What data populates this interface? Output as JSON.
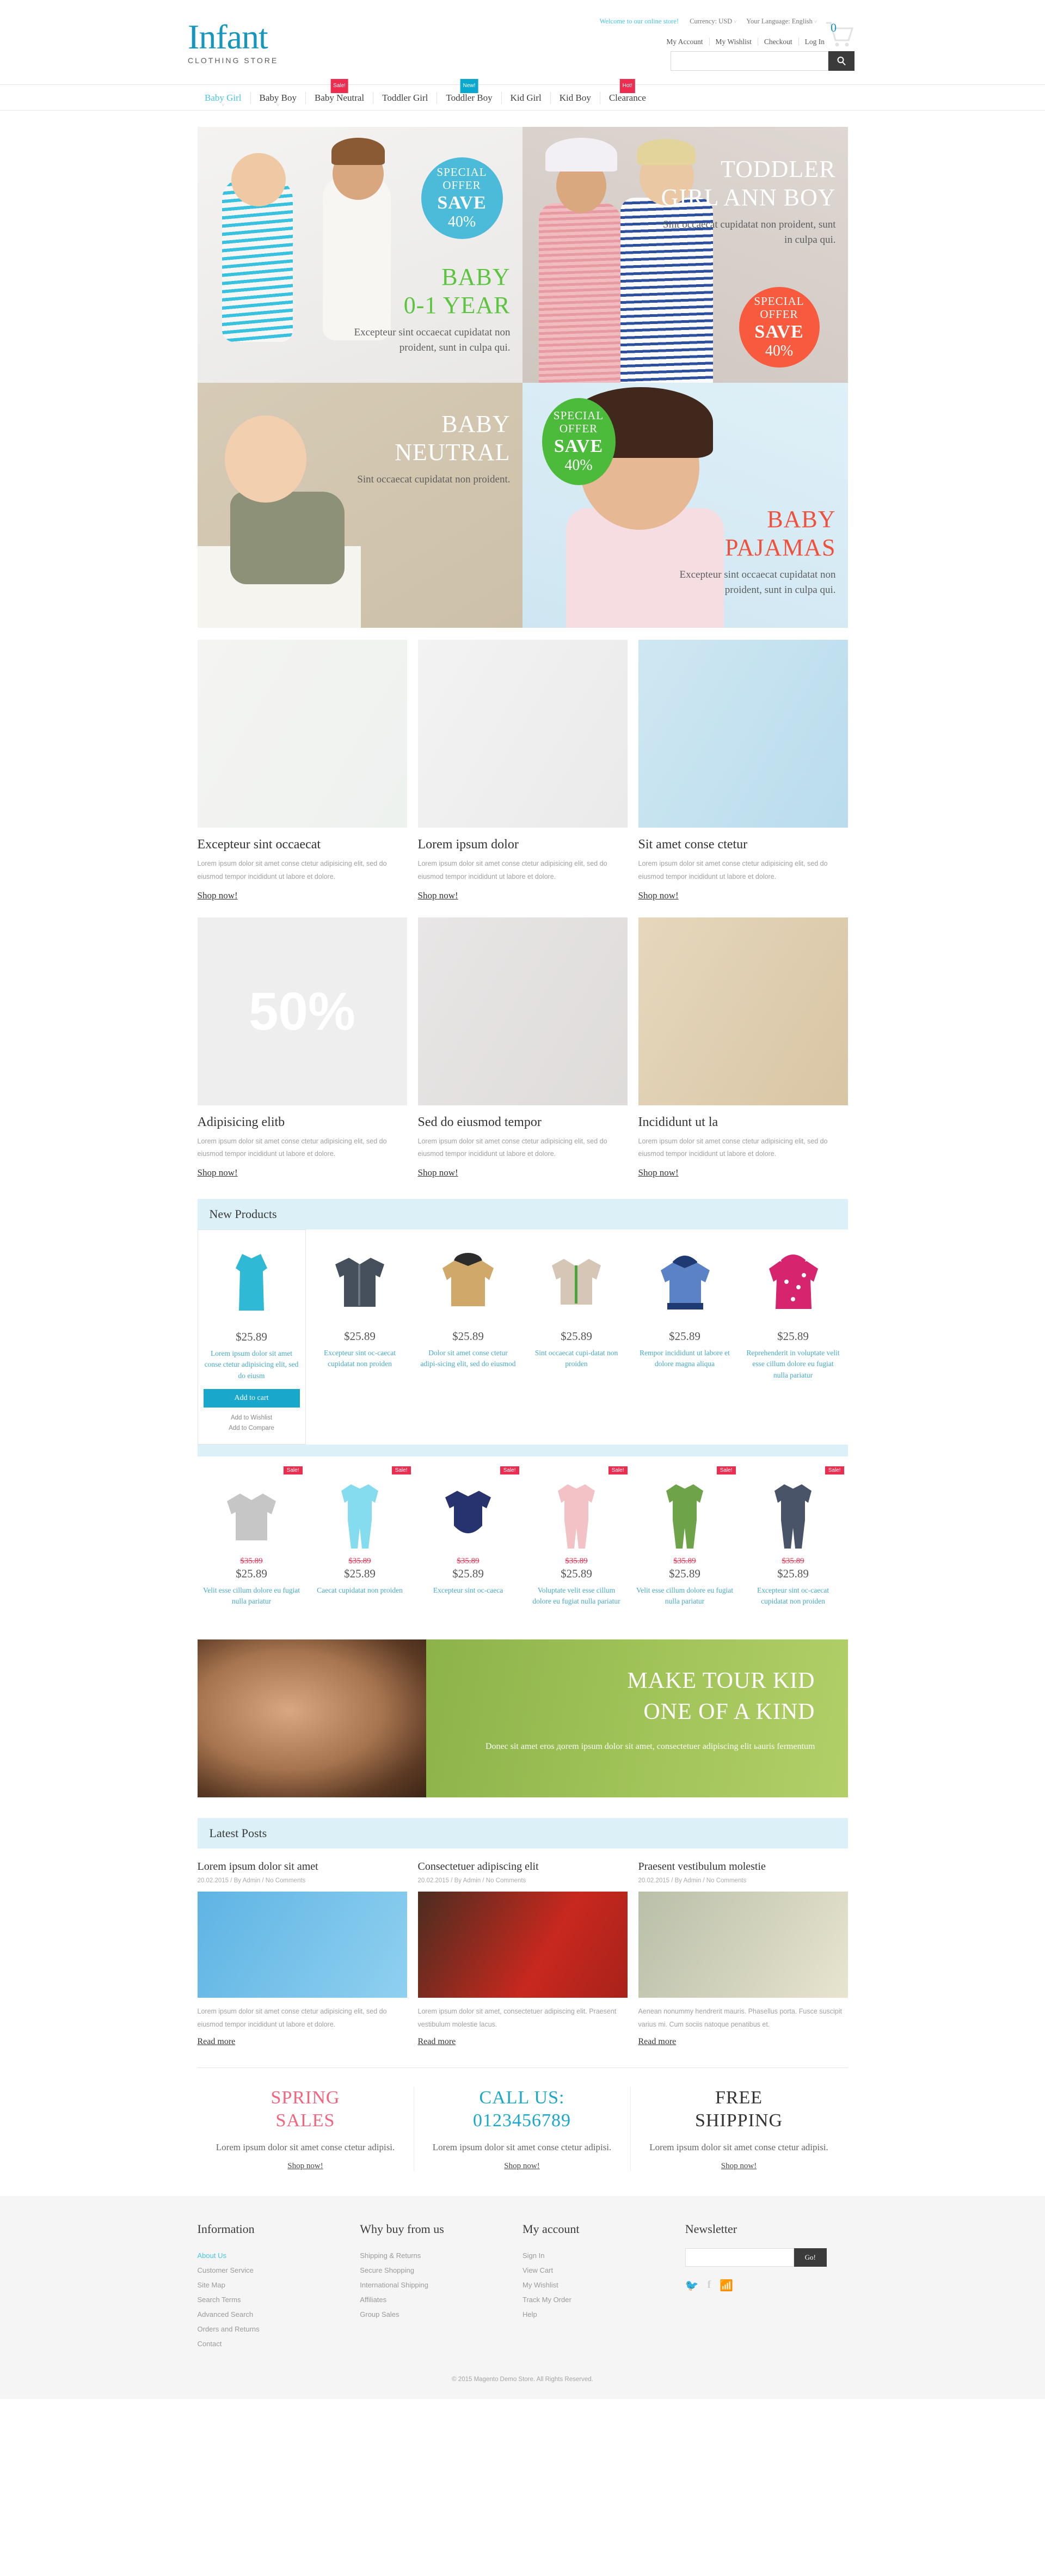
{
  "header": {
    "logo_name": "Infant",
    "logo_sub": "CLOTHING STORE",
    "welcome": "Welcome to our online store!",
    "currency": "Currency: USD",
    "language": "Your Language: English",
    "caret": "˅",
    "cart_count": "0",
    "links": [
      "My Account",
      "My Wishlist",
      "Checkout",
      "Log In"
    ],
    "search_placeholder": "",
    "search_value": "",
    "search_icon": "⚲"
  },
  "nav": {
    "items": [
      {
        "label": "Baby Girl",
        "badge": "",
        "badge_type": "",
        "active": true,
        "dropdown": true
      },
      {
        "label": "Baby Boy",
        "badge": "",
        "badge_type": "",
        "active": false,
        "dropdown": true
      },
      {
        "label": "Baby Neutral",
        "badge": "Sale!",
        "badge_type": "sale",
        "active": false,
        "dropdown": false
      },
      {
        "label": "Toddler Girl",
        "badge": "",
        "badge_type": "",
        "active": false,
        "dropdown": false
      },
      {
        "label": "Toddler Boy",
        "badge": "New!",
        "badge_type": "new",
        "active": false,
        "dropdown": false
      },
      {
        "label": "Kid Girl",
        "badge": "",
        "badge_type": "",
        "active": false,
        "dropdown": false
      },
      {
        "label": "Kid Boy",
        "badge": "",
        "badge_type": "",
        "active": false,
        "dropdown": false
      },
      {
        "label": "Clearance",
        "badge": "Hot!",
        "badge_type": "hot",
        "active": false,
        "dropdown": false
      }
    ]
  },
  "hero": {
    "tl": {
      "circle": {
        "line1": "SPECIAL",
        "line2": "OFFER",
        "line3": "SAVE",
        "line4": "40%",
        "color": "#4bbbd9"
      },
      "title1": "BABY",
      "title2": "0-1 YEAR",
      "text": "Excepteur sint occaecat cupidatat non proident, sunt in culpa qui."
    },
    "tr": {
      "circle": {
        "line1": "SPECIAL",
        "line2": "OFFER",
        "line3": "SAVE",
        "line4": "40%",
        "color": "#f85a3e"
      },
      "title1": "TODDLER",
      "title2": "GIRL ANN BOY",
      "text": "Sint occaecat cupidatat non proident, sunt in culpa qui."
    },
    "bl": {
      "title1": "BABY",
      "title2": "NEUTRAL",
      "text": "Sint occaecat cupidatat non proident."
    },
    "br": {
      "circle": {
        "line1": "SPECIAL",
        "line2": "OFFER",
        "line3": "SAVE",
        "line4": "40%",
        "color": "#4cbb3c"
      },
      "title1": "BABY",
      "title2": "PAJAMAS",
      "text": "Excepteur sint occaecat cupidatat non proident, sunt in culpa qui."
    }
  },
  "categories_row1": [
    {
      "title": "Excepteur sint occaecat",
      "text": "Lorem ipsum dolor sit amet conse ctetur adipisicing elit, sed do eiusmod tempor incididunt ut labore et dolore.",
      "link": "Shop now!"
    },
    {
      "title": "Lorem ipsum dolor",
      "text": "Lorem ipsum dolor sit amet conse ctetur adipisicing elit, sed do eiusmod tempor incididunt ut labore et dolore.",
      "link": "Shop now!"
    },
    {
      "title": "Sit amet conse ctetur",
      "text": "Lorem ipsum dolor sit amet conse ctetur adipisicing elit, sed do eiusmod tempor incididunt ut labore et dolore.",
      "link": "Shop now!"
    }
  ],
  "categories_row2": [
    {
      "title": "Adipisicing elitb",
      "text": "Lorem ipsum dolor sit amet conse ctetur adipisicing elit, sed do eiusmod tempor incididunt ut labore et dolore.",
      "link": "Shop now!",
      "discount": "50%"
    },
    {
      "title": "Sed do eiusmod tempor",
      "text": "Lorem ipsum dolor sit amet conse ctetur adipisicing elit, sed do eiusmod tempor incididunt ut labore et dolore.",
      "link": "Shop now!"
    },
    {
      "title": "Incididunt ut la",
      "text": "Lorem ipsum dolor sit amet conse ctetur adipisicing elit, sed do eiusmod tempor incididunt ut labore et dolore.",
      "link": "Shop now!"
    }
  ],
  "new_products": {
    "title": "New Products",
    "add_to_cart": "Add to cart",
    "add_wishlist": "Add to Wishlist",
    "add_compare": "Add to Compare",
    "items": [
      {
        "price": "$25.89",
        "name": "Lorem ipsum dolor sit amet conse ctetur adipisicing elit, sed do eiusm",
        "featured": true
      },
      {
        "price": "$25.89",
        "name": "Excepteur sint oc-caecat cupidatat non proiden",
        "featured": false
      },
      {
        "price": "$25.89",
        "name": "Dolor sit amet conse ctetur adipi-sicing elit, sed do eiusmod",
        "featured": false
      },
      {
        "price": "$25.89",
        "name": "Sint occaecat cupi-datat non proiden",
        "featured": false
      },
      {
        "price": "$25.89",
        "name": "Rempor incididunt ut labore et dolore magna aliqua",
        "featured": false
      },
      {
        "price": "$25.89",
        "name": "Reprehenderit in voluptate velit esse cillum dolore eu fugiat nulla pariatur",
        "featured": false
      }
    ]
  },
  "sale_products": {
    "tag": "Sale!",
    "items": [
      {
        "old_price": "$35.89",
        "price": "$25.89",
        "name": "Velit esse cillum dolore eu fugiat nulla pariatur"
      },
      {
        "old_price": "$35.89",
        "price": "$25.89",
        "name": "Caecat cupidatat non proiden"
      },
      {
        "old_price": "$35.89",
        "price": "$25.89",
        "name": "Excepteur sint oc-caeca"
      },
      {
        "old_price": "$35.89",
        "price": "$25.89",
        "name": "Voluptate velit esse cillum dolore eu fugiat nulla pariatur"
      },
      {
        "old_price": "$35.89",
        "price": "$25.89",
        "name": "Velit esse cillum dolore eu fugiat nulla pariatur"
      },
      {
        "old_price": "$35.89",
        "price": "$25.89",
        "name": "Excepteur sint oc-caecat cupidatat non proiden"
      }
    ]
  },
  "promo": {
    "line1": "MAKE TOUR KID",
    "line2": "ONE OF A KIND",
    "text": "Donec sit amet eros дorem ipsum dolor sit amet, consectetuer adipiscing elit ьauris fermentum"
  },
  "blog": {
    "title": "Latest Posts",
    "posts": [
      {
        "title": "Lorem ipsum dolor sit amet",
        "meta": "20.02.2015  /  By Admin  /  No Comments",
        "text": "Lorem ipsum dolor sit amet conse ctetur adipisicing elit, sed do eiusmod tempor incididunt ut labore et dolore.",
        "link": "Read more"
      },
      {
        "title": "Consectetuer adipiscing elit",
        "meta": "20.02.2015  /  By Admin  /  No Comments",
        "text": "Lorem ipsum dolor sit amet, consectetuer adipiscing elit. Praesent vestibulum molestie lacus.",
        "link": "Read more"
      },
      {
        "title": "Praesent vestibulum molestie",
        "meta": "20.02.2015  /  By Admin  /  No Comments",
        "text": "Aenean nonummy hendrerit mauris. Phasellus porta. Fusce suscipit varius mi. Cum sociis natoque penatibus et.",
        "link": "Read more"
      }
    ]
  },
  "features": [
    {
      "line1": "SPRING",
      "line2": "SALES",
      "color": "pink",
      "text": "Lorem ipsum dolor sit amet conse ctetur adipisi.",
      "link": "Shop now!"
    },
    {
      "line1": "CALL US:",
      "line2": "0123456789",
      "color": "cyan",
      "text": "Lorem ipsum dolor sit amet conse ctetur adipisi.",
      "link": "Shop now!"
    },
    {
      "line1": "FREE",
      "line2": "SHIPPING",
      "color": "dark",
      "text": "Lorem ipsum dolor sit amet conse ctetur adipisi.",
      "link": "Shop now!"
    }
  ],
  "footer": {
    "columns": [
      {
        "heading": "Information",
        "links": [
          "About Us",
          "Customer Service",
          "Site Map",
          "Search Terms",
          "Advanced Search",
          "Orders and Returns",
          "Contact"
        ],
        "active_index": 0
      },
      {
        "heading": "Why buy from us",
        "links": [
          "Shipping & Returns",
          "Secure Shopping",
          "International Shipping",
          "Affiliates",
          "Group Sales"
        ],
        "active_index": -1
      },
      {
        "heading": "My account",
        "links": [
          "Sign In",
          "View Cart",
          "My Wishlist",
          "Track My Order",
          "Help"
        ],
        "active_index": -1
      }
    ],
    "newsletter": {
      "heading": "Newsletter",
      "placeholder": "",
      "value": "",
      "button": "Go!",
      "socials": [
        "twitter-icon",
        "facebook-icon",
        "rss-icon"
      ]
    },
    "copyright": "© 2015 Magento Demo Store. All Rights Reserved."
  }
}
